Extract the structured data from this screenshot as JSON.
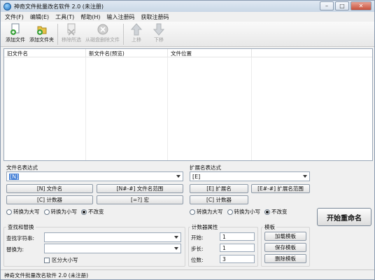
{
  "window": {
    "title": "神奇文件批量改名软件 2.0 (未注册)",
    "controls": {
      "minimize": "–",
      "maximize": "□",
      "close": "✕"
    }
  },
  "menu": [
    "文件(F)",
    "编辑(E)",
    "工具(T)",
    "帮助(H)",
    "输入注册码",
    "获取注册码"
  ],
  "toolbar": {
    "add_file": "添加文件",
    "add_folder": "添加文件夹",
    "remove_selected": "移除所选",
    "delete_from_disk": "从磁盘删除文件",
    "move_up": "上移",
    "move_down": "下移"
  },
  "file_list": {
    "columns": [
      "旧文件名",
      "新文件名(预览)",
      "文件位置"
    ]
  },
  "filename_expr": {
    "title": "文件名表达式",
    "value": "[N]",
    "btn_name": "[N] 文件名",
    "btn_range": "[N#-#] 文件名范围",
    "btn_counter": "[C] 计数器",
    "btn_macro": "[=?] 宏"
  },
  "ext_expr": {
    "title": "扩展名表达式",
    "value": "[E]",
    "btn_ext": "[E] 扩展名",
    "btn_range": "[E#-#] 扩展名范围",
    "btn_counter": "[C] 计数器"
  },
  "case_options": {
    "upper": "转换为大写",
    "lower": "转换为小写",
    "keep": "不改变"
  },
  "find_replace": {
    "title": "查找和替换",
    "find_label": "查找字符串:",
    "replace_label": "替换为:",
    "case_sensitive": "区分大小写"
  },
  "counter": {
    "title": "计数器属性",
    "start_label": "开始:",
    "start_value": "1",
    "step_label": "步长:",
    "step_value": "1",
    "digits_label": "位数:",
    "digits_value": "3"
  },
  "template": {
    "title": "模板",
    "load": "加载模板",
    "save": "保存模板",
    "delete": "删除模板"
  },
  "start_button": "开始重命名",
  "status": "神奇文件批量改名软件 2.0 (未注册)"
}
